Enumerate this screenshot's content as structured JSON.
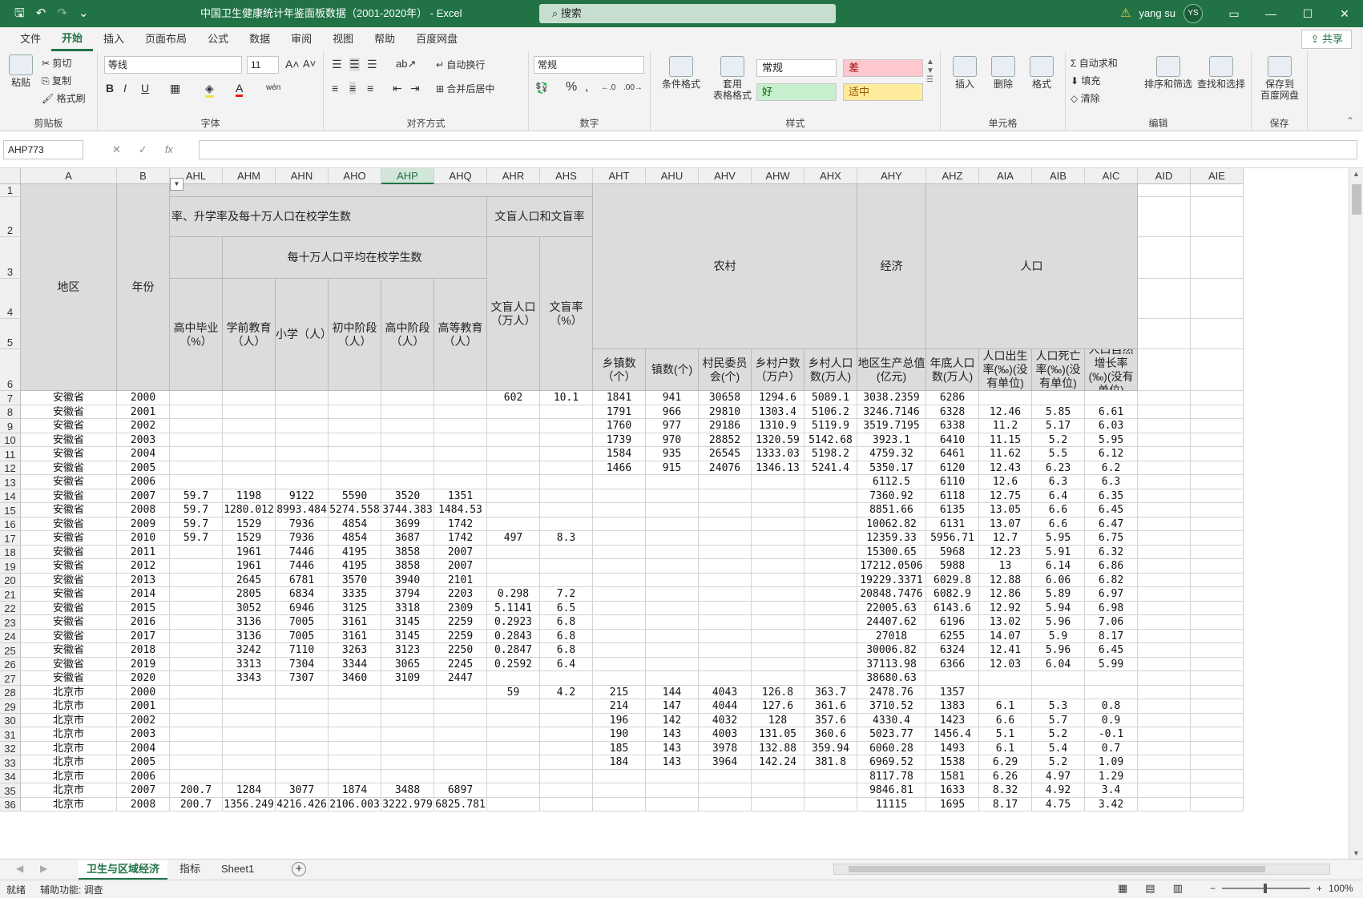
{
  "window": {
    "title": "中国卫生健康统计年鉴面板数据（2001-2020年） - Excel",
    "search_placeholder": "搜索",
    "user_name": "yang su",
    "user_initials": "YS"
  },
  "menu": {
    "tabs": [
      "文件",
      "开始",
      "插入",
      "页面布局",
      "公式",
      "数据",
      "审阅",
      "视图",
      "帮助",
      "百度网盘"
    ],
    "active": "开始",
    "share": "共享"
  },
  "ribbon": {
    "clipboard": {
      "paste": "粘贴",
      "cut": "剪切",
      "copy": "复制",
      "format_painter": "格式刷",
      "label": "剪贴板"
    },
    "font": {
      "name": "等线",
      "size": "11",
      "label": "字体",
      "wen": "wén"
    },
    "alignment": {
      "wrap": "自动换行",
      "merge": "合并后居中",
      "label": "对齐方式"
    },
    "number": {
      "format": "常规",
      "label": "数字"
    },
    "styles": {
      "conditional": "条件格式",
      "table": "套用\n表格格式",
      "label": "样式",
      "normal": "常规",
      "bad": "差",
      "good": "好",
      "neutral": "适中"
    },
    "cells": {
      "insert": "插入",
      "delete": "删除",
      "format": "格式",
      "label": "单元格"
    },
    "editing": {
      "autosum": "自动求和",
      "fill": "填充",
      "clear": "清除",
      "sort": "排序和筛选",
      "find": "查找和选择",
      "label": "编辑"
    },
    "save": {
      "baidu": "保存到\n百度网盘",
      "label": "保存"
    }
  },
  "formula_bar": {
    "name_box": "AHP773",
    "formula": ""
  },
  "grid": {
    "selected_column": "AHP",
    "columns": [
      "A",
      "B",
      "AHL",
      "AHM",
      "AHN",
      "AHO",
      "AHP",
      "AHQ",
      "AHR",
      "AHS",
      "AHT",
      "AHU",
      "AHV",
      "AHW",
      "AHX",
      "AHY",
      "AHZ",
      "AIA",
      "AIB",
      "AIC",
      "AID",
      "AIE"
    ],
    "header_labels": {
      "region": "地区",
      "year": "年份",
      "edu_group": "率、升学率及每十万人口在校学生数",
      "per100k": "每十万人口平均在校学生数",
      "illit_group": "文盲人口和文盲率",
      "rural": "农村",
      "economy": "经济",
      "population": "人口",
      "sub": {
        "AHL": "高中毕业（%）",
        "AHM": "学前教育（人）",
        "AHN": "小学（人）",
        "AHO": "初中阶段（人）",
        "AHP": "高中阶段（人）",
        "AHQ": "高等教育（人）",
        "AHR": "文盲人口（万人）",
        "AHS": "文盲率（%）",
        "AHT": "乡镇数（个）",
        "AHU": "镇数(个)",
        "AHV": "村民委员会(个)",
        "AHW": "乡村户数（万户）",
        "AHX": "乡村人口数(万人)",
        "AHY": "地区生产总值(亿元)",
        "AHZ": "年底人口数(万人)",
        "AIA": "人口出生率(‰)(没有单位)",
        "AIB": "人口死亡率(‰)(没有单位)",
        "AIC": "人口自然增长率(‰)(没有单位)"
      }
    },
    "rows": [
      [
        7,
        "安徽省",
        "2000",
        "",
        "",
        "",
        "",
        "",
        "",
        "602",
        "10.1",
        "1841",
        "941",
        "30658",
        "1294.6",
        "5089.1",
        "3038.2359",
        "6286",
        "",
        "",
        ""
      ],
      [
        8,
        "安徽省",
        "2001",
        "",
        "",
        "",
        "",
        "",
        "",
        "",
        "",
        "1791",
        "966",
        "29810",
        "1303.4",
        "5106.2",
        "3246.7146",
        "6328",
        "12.46",
        "5.85",
        "6.61"
      ],
      [
        9,
        "安徽省",
        "2002",
        "",
        "",
        "",
        "",
        "",
        "",
        "",
        "",
        "1760",
        "977",
        "29186",
        "1310.9",
        "5119.9",
        "3519.7195",
        "6338",
        "11.2",
        "5.17",
        "6.03"
      ],
      [
        10,
        "安徽省",
        "2003",
        "",
        "",
        "",
        "",
        "",
        "",
        "",
        "",
        "1739",
        "970",
        "28852",
        "1320.59",
        "5142.68",
        "3923.1",
        "6410",
        "11.15",
        "5.2",
        "5.95"
      ],
      [
        11,
        "安徽省",
        "2004",
        "",
        "",
        "",
        "",
        "",
        "",
        "",
        "",
        "1584",
        "935",
        "26545",
        "1333.03",
        "5198.2",
        "4759.32",
        "6461",
        "11.62",
        "5.5",
        "6.12"
      ],
      [
        12,
        "安徽省",
        "2005",
        "",
        "",
        "",
        "",
        "",
        "",
        "",
        "",
        "1466",
        "915",
        "24076",
        "1346.13",
        "5241.4",
        "5350.17",
        "6120",
        "12.43",
        "6.23",
        "6.2"
      ],
      [
        13,
        "安徽省",
        "2006",
        "",
        "",
        "",
        "",
        "",
        "",
        "",
        "",
        "",
        "",
        "",
        "",
        "",
        "6112.5",
        "6110",
        "12.6",
        "6.3",
        "6.3"
      ],
      [
        14,
        "安徽省",
        "2007",
        "59.7",
        "1198",
        "9122",
        "5590",
        "3520",
        "1351",
        "",
        "",
        "",
        "",
        "",
        "",
        "",
        "7360.92",
        "6118",
        "12.75",
        "6.4",
        "6.35"
      ],
      [
        15,
        "安徽省",
        "2008",
        "59.7",
        "1280.012",
        "8993.484",
        "5274.558",
        "3744.383",
        "1484.53",
        "",
        "",
        "",
        "",
        "",
        "",
        "",
        "8851.66",
        "6135",
        "13.05",
        "6.6",
        "6.45"
      ],
      [
        16,
        "安徽省",
        "2009",
        "59.7",
        "1529",
        "7936",
        "4854",
        "3699",
        "1742",
        "",
        "",
        "",
        "",
        "",
        "",
        "",
        "10062.82",
        "6131",
        "13.07",
        "6.6",
        "6.47"
      ],
      [
        17,
        "安徽省",
        "2010",
        "59.7",
        "1529",
        "7936",
        "4854",
        "3687",
        "1742",
        "497",
        "8.3",
        "",
        "",
        "",
        "",
        "",
        "12359.33",
        "5956.71",
        "12.7",
        "5.95",
        "6.75"
      ],
      [
        18,
        "安徽省",
        "2011",
        "",
        "1961",
        "7446",
        "4195",
        "3858",
        "2007",
        "",
        "",
        "",
        "",
        "",
        "",
        "",
        "15300.65",
        "5968",
        "12.23",
        "5.91",
        "6.32"
      ],
      [
        19,
        "安徽省",
        "2012",
        "",
        "1961",
        "7446",
        "4195",
        "3858",
        "2007",
        "",
        "",
        "",
        "",
        "",
        "",
        "",
        "17212.0506",
        "5988",
        "13",
        "6.14",
        "6.86"
      ],
      [
        20,
        "安徽省",
        "2013",
        "",
        "2645",
        "6781",
        "3570",
        "3940",
        "2101",
        "",
        "",
        "",
        "",
        "",
        "",
        "",
        "19229.3371",
        "6029.8",
        "12.88",
        "6.06",
        "6.82"
      ],
      [
        21,
        "安徽省",
        "2014",
        "",
        "2805",
        "6834",
        "3335",
        "3794",
        "2203",
        "0.298",
        "7.2",
        "",
        "",
        "",
        "",
        "",
        "20848.7476",
        "6082.9",
        "12.86",
        "5.89",
        "6.97"
      ],
      [
        22,
        "安徽省",
        "2015",
        "",
        "3052",
        "6946",
        "3125",
        "3318",
        "2309",
        "5.1141",
        "6.5",
        "",
        "",
        "",
        "",
        "",
        "22005.63",
        "6143.6",
        "12.92",
        "5.94",
        "6.98"
      ],
      [
        23,
        "安徽省",
        "2016",
        "",
        "3136",
        "7005",
        "3161",
        "3145",
        "2259",
        "0.2923",
        "6.8",
        "",
        "",
        "",
        "",
        "",
        "24407.62",
        "6196",
        "13.02",
        "5.96",
        "7.06"
      ],
      [
        24,
        "安徽省",
        "2017",
        "",
        "3136",
        "7005",
        "3161",
        "3145",
        "2259",
        "0.2843",
        "6.8",
        "",
        "",
        "",
        "",
        "",
        "27018",
        "6255",
        "14.07",
        "5.9",
        "8.17"
      ],
      [
        25,
        "安徽省",
        "2018",
        "",
        "3242",
        "7110",
        "3263",
        "3123",
        "2250",
        "0.2847",
        "6.8",
        "",
        "",
        "",
        "",
        "",
        "30006.82",
        "6324",
        "12.41",
        "5.96",
        "6.45"
      ],
      [
        26,
        "安徽省",
        "2019",
        "",
        "3313",
        "7304",
        "3344",
        "3065",
        "2245",
        "0.2592",
        "6.4",
        "",
        "",
        "",
        "",
        "",
        "37113.98",
        "6366",
        "12.03",
        "6.04",
        "5.99"
      ],
      [
        27,
        "安徽省",
        "2020",
        "",
        "3343",
        "7307",
        "3460",
        "3109",
        "2447",
        "",
        "",
        "",
        "",
        "",
        "",
        "",
        "38680.63",
        "",
        "",
        "",
        ""
      ],
      [
        28,
        "北京市",
        "2000",
        "",
        "",
        "",
        "",
        "",
        "",
        "59",
        "4.2",
        "215",
        "144",
        "4043",
        "126.8",
        "363.7",
        "2478.76",
        "1357",
        "",
        "",
        ""
      ],
      [
        29,
        "北京市",
        "2001",
        "",
        "",
        "",
        "",
        "",
        "",
        "",
        "",
        "214",
        "147",
        "4044",
        "127.6",
        "361.6",
        "3710.52",
        "1383",
        "6.1",
        "5.3",
        "0.8"
      ],
      [
        30,
        "北京市",
        "2002",
        "",
        "",
        "",
        "",
        "",
        "",
        "",
        "",
        "196",
        "142",
        "4032",
        "128",
        "357.6",
        "4330.4",
        "1423",
        "6.6",
        "5.7",
        "0.9"
      ],
      [
        31,
        "北京市",
        "2003",
        "",
        "",
        "",
        "",
        "",
        "",
        "",
        "",
        "190",
        "143",
        "4003",
        "131.05",
        "360.6",
        "5023.77",
        "1456.4",
        "5.1",
        "5.2",
        "-0.1"
      ],
      [
        32,
        "北京市",
        "2004",
        "",
        "",
        "",
        "",
        "",
        "",
        "",
        "",
        "185",
        "143",
        "3978",
        "132.88",
        "359.94",
        "6060.28",
        "1493",
        "6.1",
        "5.4",
        "0.7"
      ],
      [
        33,
        "北京市",
        "2005",
        "",
        "",
        "",
        "",
        "",
        "",
        "",
        "",
        "184",
        "143",
        "3964",
        "142.24",
        "381.8",
        "6969.52",
        "1538",
        "6.29",
        "5.2",
        "1.09"
      ],
      [
        34,
        "北京市",
        "2006",
        "",
        "",
        "",
        "",
        "",
        "",
        "",
        "",
        "",
        "",
        "",
        "",
        "",
        "8117.78",
        "1581",
        "6.26",
        "4.97",
        "1.29"
      ],
      [
        35,
        "北京市",
        "2007",
        "200.7",
        "1284",
        "3077",
        "1874",
        "3488",
        "6897",
        "",
        "",
        "",
        "",
        "",
        "",
        "",
        "9846.81",
        "1633",
        "8.32",
        "4.92",
        "3.4"
      ],
      [
        36,
        "北京市",
        "2008",
        "200.7",
        "1356.249",
        "4216.426",
        "2106.003",
        "3222.979",
        "6825.781",
        "",
        "",
        "",
        "",
        "",
        "",
        "",
        "11115",
        "1695",
        "8.17",
        "4.75",
        "3.42"
      ]
    ]
  },
  "sheets": {
    "tabs": [
      "卫生与区域经济",
      "指标",
      "Sheet1"
    ],
    "active": "卫生与区域经济",
    "add": "+"
  },
  "status": {
    "ready": "就绪",
    "accessibility": "辅助功能: 调查",
    "zoom": "100%"
  }
}
